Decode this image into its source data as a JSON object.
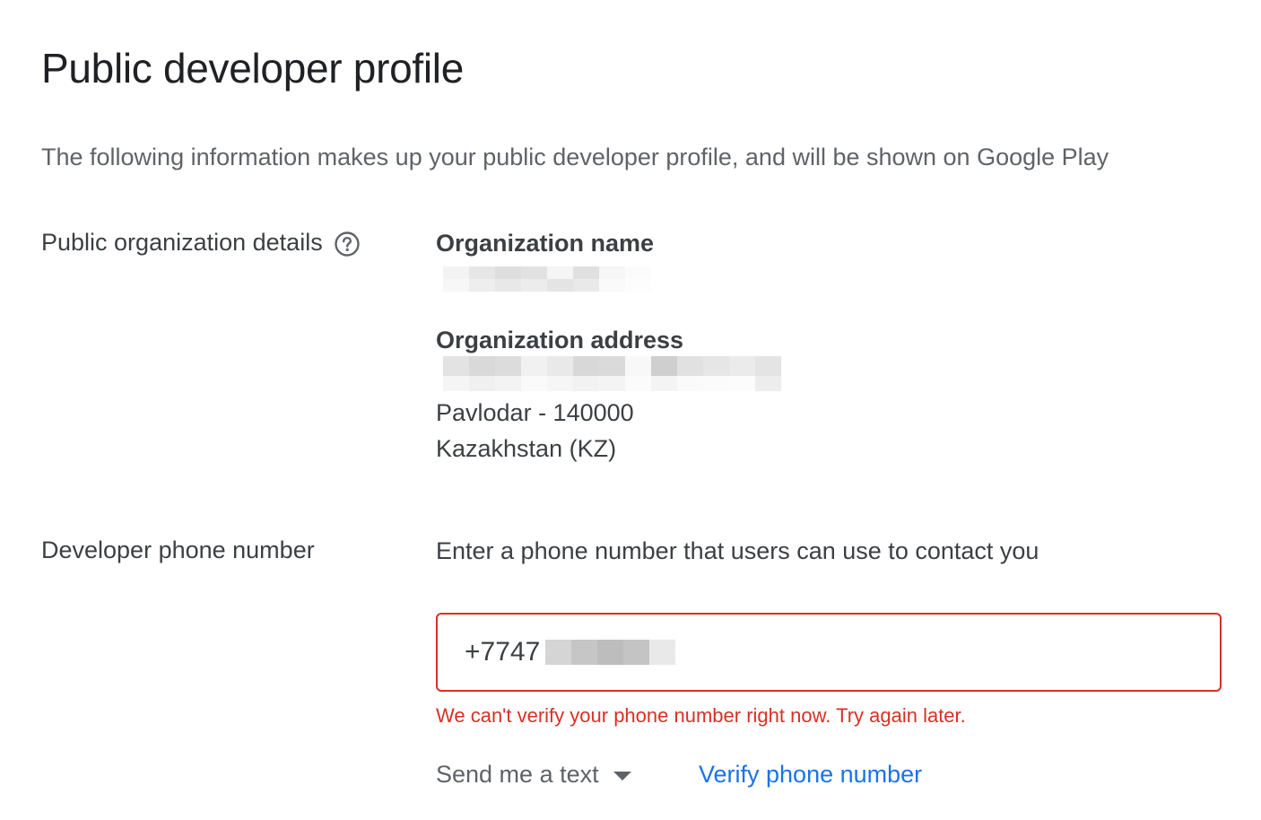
{
  "header": {
    "title": "Public developer profile",
    "subtitle": "The following information makes up your public developer profile, and will be shown on Google Play"
  },
  "org_section": {
    "label": "Public organization details",
    "help_icon": "help-circle-icon",
    "name_heading": "Organization name",
    "address_heading": "Organization address",
    "address_city_line": "Pavlodar - 140000",
    "address_country_line": "Kazakhstan (KZ)"
  },
  "phone_section": {
    "label": "Developer phone number",
    "prompt": "Enter a phone number that users can use to contact you",
    "value": "+7747",
    "error": "We can't verify your phone number right now. Try again later.",
    "method_label": "Send me a text",
    "verify_label": "Verify phone number"
  },
  "colors": {
    "error": "#d93025",
    "link": "#1a73e8",
    "text_primary": "#202124",
    "text_secondary": "#5f6368"
  }
}
